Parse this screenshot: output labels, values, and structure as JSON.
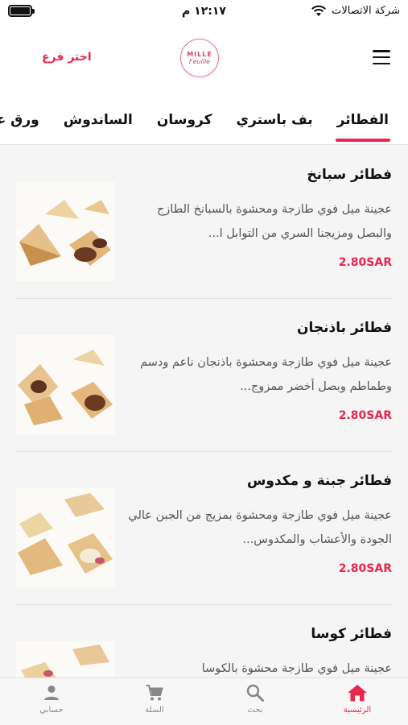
{
  "status_bar": {
    "carrier": "شركة الاتصالات",
    "time": "١٢:١٧ م"
  },
  "header": {
    "branch_link": "اختر فرع",
    "logo_top": "MILLE",
    "logo_bottom": "Feuille"
  },
  "tabs": [
    {
      "label": "الفطائر",
      "active": true
    },
    {
      "label": "بف باستري"
    },
    {
      "label": "كروسان"
    },
    {
      "label": "الساندوش"
    },
    {
      "label": "ورق عنب"
    }
  ],
  "items": [
    {
      "title": "فطائر سبانخ",
      "description": "عجينة ميل فوي طازجة ومحشوة بالسبانخ الطازج والبصل ومزيجنا السري من التوابل ا...",
      "price": "2.80SAR"
    },
    {
      "title": "فطائر باذنجان",
      "description": "عجينة ميل فوي طازجة ومحشوة باذنجان ناعم ودسم وطماطم وبصل أخضر ممزوج...",
      "price": "2.80SAR"
    },
    {
      "title": "فطائر جبنة و مكدوس",
      "description": "عجينة ميل فوي طازجة ومحشوة بمزيج من الجبن عالي الجودة والأعشاب والمكدوس...",
      "price": "2.80SAR"
    },
    {
      "title": "فطائر كوسا",
      "description": "عجينة ميل فوي طازجة محشوة بالكوسا",
      "price": ""
    }
  ],
  "bottom_nav": {
    "home": "الرئيسية",
    "search": "بحث",
    "cart": "السلة",
    "account": "حسابي"
  },
  "colors": {
    "accent": "#e8274f",
    "logo": "#d4475f"
  }
}
